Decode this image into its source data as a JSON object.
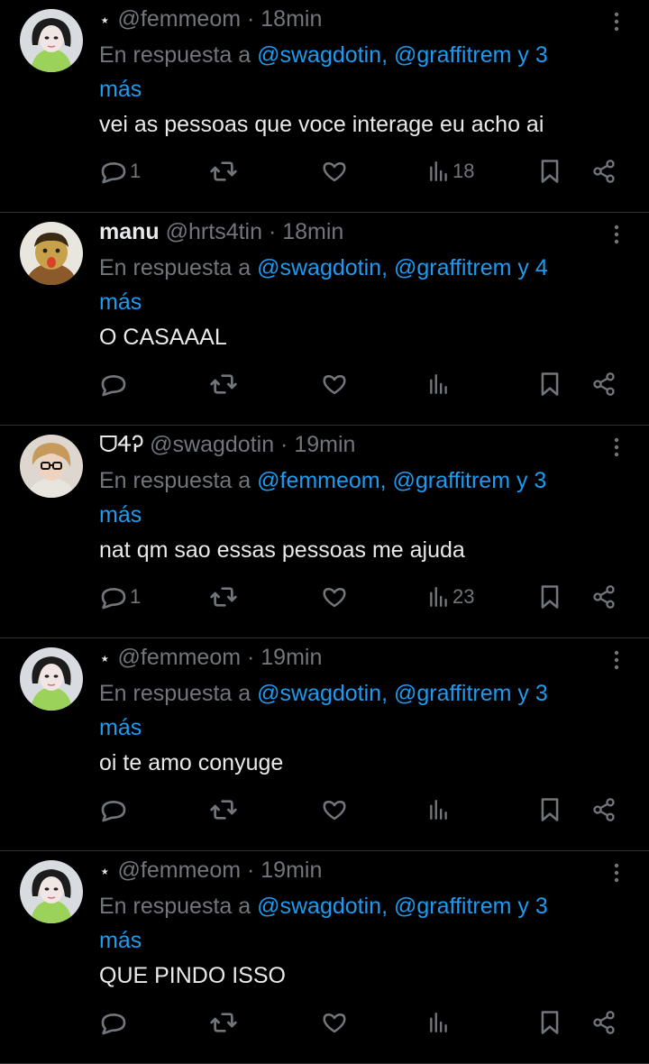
{
  "colors": {
    "background": "#000000",
    "text": "#e7e9ea",
    "secondary": "#71767b",
    "link": "#1d9bf0",
    "divider": "#2f3336"
  },
  "tweets": [
    {
      "prefix": "⋆",
      "display_name": "",
      "handle": "@femmeom",
      "time": "· 18min",
      "reply_prefix": "En respuesta a",
      "reply_users": "@swagdotin, @graffitrem y 3",
      "reply_more": "más",
      "text": "vei as pessoas que voce interage eu acho ai",
      "reply_count": "1",
      "retweet_count": "",
      "like_count": "",
      "view_count": "18"
    },
    {
      "prefix": "",
      "display_name": "manu",
      "handle": "@hrts4tin",
      "time": "· 18min",
      "reply_prefix": "En respuesta a",
      "reply_users": "@swagdotin, @graffitrem y 4",
      "reply_more": "más",
      "text": "O CASAAAL",
      "reply_count": "",
      "retweet_count": "",
      "like_count": "",
      "view_count": ""
    },
    {
      "prefix": "",
      "display_name": "ᗜᏎᎮ",
      "handle": "@swagdotin",
      "time": "· 19min",
      "reply_prefix": "En respuesta a",
      "reply_users": "@femmeom, @graffitrem y 3",
      "reply_more": "más",
      "text": "nat qm sao essas pessoas me ajuda",
      "reply_count": "1",
      "retweet_count": "",
      "like_count": "",
      "view_count": "23"
    },
    {
      "prefix": "⋆",
      "display_name": "",
      "handle": "@femmeom",
      "time": "· 19min",
      "reply_prefix": "En respuesta a",
      "reply_users": "@swagdotin, @graffitrem y 3",
      "reply_more": "más",
      "text": "oi te amo conyuge",
      "reply_count": "",
      "retweet_count": "",
      "like_count": "",
      "view_count": ""
    },
    {
      "prefix": "⋆",
      "display_name": "",
      "handle": "@femmeom",
      "time": "· 19min",
      "reply_prefix": "En respuesta a",
      "reply_users": "@swagdotin, @graffitrem y 3",
      "reply_more": "más",
      "text": "QUE PINDO ISSO",
      "reply_count": "",
      "retweet_count": "",
      "like_count": "",
      "view_count": ""
    }
  ]
}
